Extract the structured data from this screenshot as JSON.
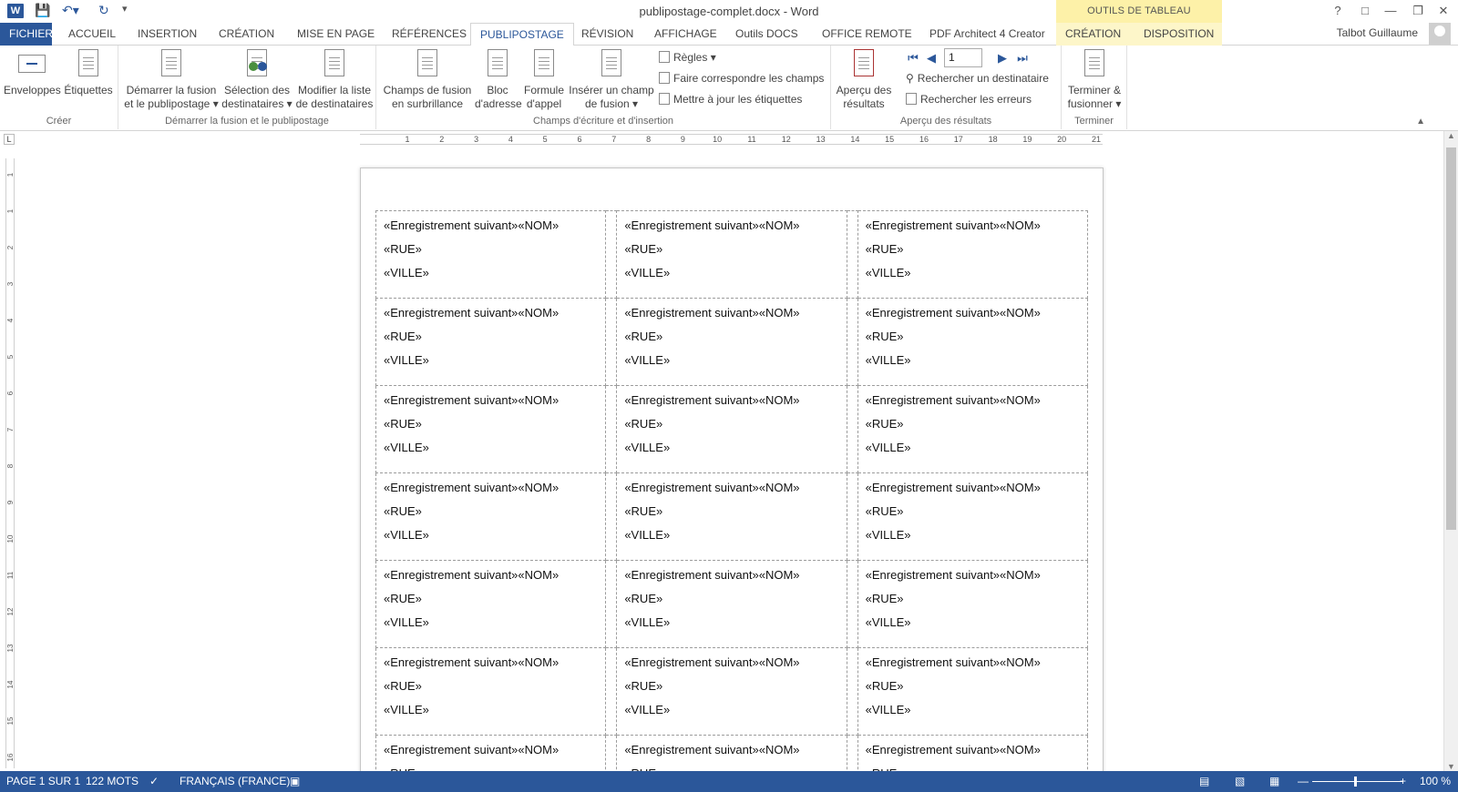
{
  "window": {
    "title": "publipostage-complet.docx - Word",
    "tools_band": "OUTILS DE TABLEAU",
    "help": "?",
    "user": "Talbot Guillaume"
  },
  "tabs": [
    {
      "label": "FICHIER"
    },
    {
      "label": "ACCUEIL"
    },
    {
      "label": "INSERTION"
    },
    {
      "label": "CRÉATION"
    },
    {
      "label": "MISE EN PAGE"
    },
    {
      "label": "RÉFÉRENCES"
    },
    {
      "label": "PUBLIPOSTAGE"
    },
    {
      "label": "RÉVISION"
    },
    {
      "label": "AFFICHAGE"
    },
    {
      "label": "Outils DOCS"
    },
    {
      "label": "OFFICE REMOTE"
    },
    {
      "label": "PDF Architect 4 Creator"
    },
    {
      "label": "CRÉATION"
    },
    {
      "label": "DISPOSITION"
    }
  ],
  "ribbon": {
    "creer": {
      "label": "Créer",
      "enveloppes": "Enveloppes",
      "etiquettes": "Étiquettes"
    },
    "demarrer": {
      "label": "Démarrer la fusion et le publipostage",
      "demarrer_l1": "Démarrer la fusion",
      "demarrer_l2": "et le publipostage",
      "selection_l1": "Sélection des",
      "selection_l2": "destinataires",
      "modifier_l1": "Modifier la liste",
      "modifier_l2": "de destinataires"
    },
    "champs": {
      "label": "Champs d'écriture et d'insertion",
      "surbrillance_l1": "Champs de fusion",
      "surbrillance_l2": "en surbrillance",
      "bloc_l1": "Bloc",
      "bloc_l2": "d'adresse",
      "formule_l1": "Formule",
      "formule_l2": "d'appel",
      "inserer_l1": "Insérer un champ",
      "inserer_l2": "de fusion",
      "regles": "Règles",
      "faire_correspondre": "Faire correspondre les champs",
      "mettre_a_jour": "Mettre à jour les étiquettes"
    },
    "apercu": {
      "label": "Aperçu des résultats",
      "apercu_l1": "Aperçu des",
      "apercu_l2": "résultats",
      "record": "1",
      "rechercher_dest": "Rechercher un destinataire",
      "rechercher_err": "Rechercher les erreurs"
    },
    "terminer": {
      "label": "Terminer",
      "l1": "Terminer &",
      "l2": "fusionner"
    }
  },
  "ruler_h": [
    "1",
    "2",
    "3",
    "4",
    "5",
    "6",
    "7",
    "8",
    "9",
    "10",
    "11",
    "12",
    "13",
    "14",
    "15",
    "16",
    "17",
    "18",
    "19",
    "20",
    "21"
  ],
  "ruler_v": [
    "1",
    "1",
    "2",
    "3",
    "4",
    "5",
    "6",
    "7",
    "8",
    "9",
    "10",
    "11",
    "12",
    "13",
    "14",
    "15",
    "16"
  ],
  "label_cell": {
    "line1": "«Enregistrement suivant»«NOM»",
    "line2": "«RUE»",
    "line3": "«VILLE»"
  },
  "status": {
    "page": "PAGE 1 SUR 1",
    "words": "122 MOTS",
    "language": "FRANÇAIS (FRANCE)",
    "zoom": "100 %"
  }
}
